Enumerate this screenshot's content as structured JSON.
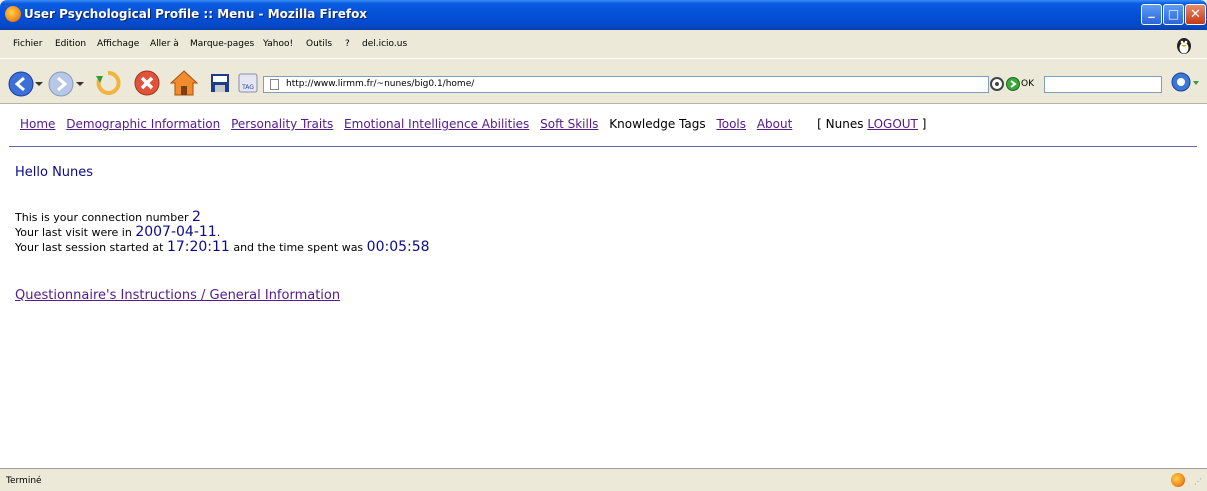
{
  "window": {
    "title": "User Psychological Profile :: Menu - Mozilla Firefox",
    "minimize_icon": "minimize-icon",
    "maximize_icon": "maximize-icon",
    "close_icon": "close-icon"
  },
  "menubar": {
    "items": [
      "Fichier",
      "Edition",
      "Affichage",
      "Aller à",
      "Marque-pages",
      "Yahoo!",
      "Outils",
      "?",
      "del.icio.us"
    ]
  },
  "toolbar": {
    "url": "http://www.lirmm.fr/~nunes/big0.1/home/",
    "ok_label": "OK",
    "icons": [
      "back-icon",
      "forward-icon",
      "reload-icon",
      "stop-icon",
      "home-icon",
      "bookmark-icon",
      "tag-icon",
      "go-icon",
      "search-engine-icon"
    ]
  },
  "nav": {
    "links": [
      {
        "label": "Home",
        "link": true
      },
      {
        "label": "Demographic Information",
        "link": true
      },
      {
        "label": "Personality Traits",
        "link": true
      },
      {
        "label": "Emotional Intelligence Abilities",
        "link": true
      },
      {
        "label": "Soft Skills",
        "link": true
      },
      {
        "label": "Knowledge Tags",
        "link": false
      },
      {
        "label": "Tools",
        "link": true
      },
      {
        "label": "About",
        "link": true
      }
    ],
    "user_open": "[ Nunes",
    "logout": "LOGOUT",
    "user_close": "]"
  },
  "main": {
    "greeting": "Hello Nunes",
    "line1_prefix": "This is your connection number",
    "connection_number": "2",
    "line2_prefix": "Your last visit were in",
    "last_visit": "2007-04-11",
    "line2_suffix": ".",
    "line3_prefix": "Your last session started at",
    "session_start": "17:20:11",
    "line3_mid": "and the time spent was",
    "time_spent": "00:05:58",
    "instructions_link": "Questionnaire's Instructions / General Information"
  },
  "statusbar": {
    "text": "Terminé"
  },
  "colors": {
    "link": "#551A8B",
    "highlight": "#0B0B8A",
    "titlebar": "#0550D8"
  }
}
